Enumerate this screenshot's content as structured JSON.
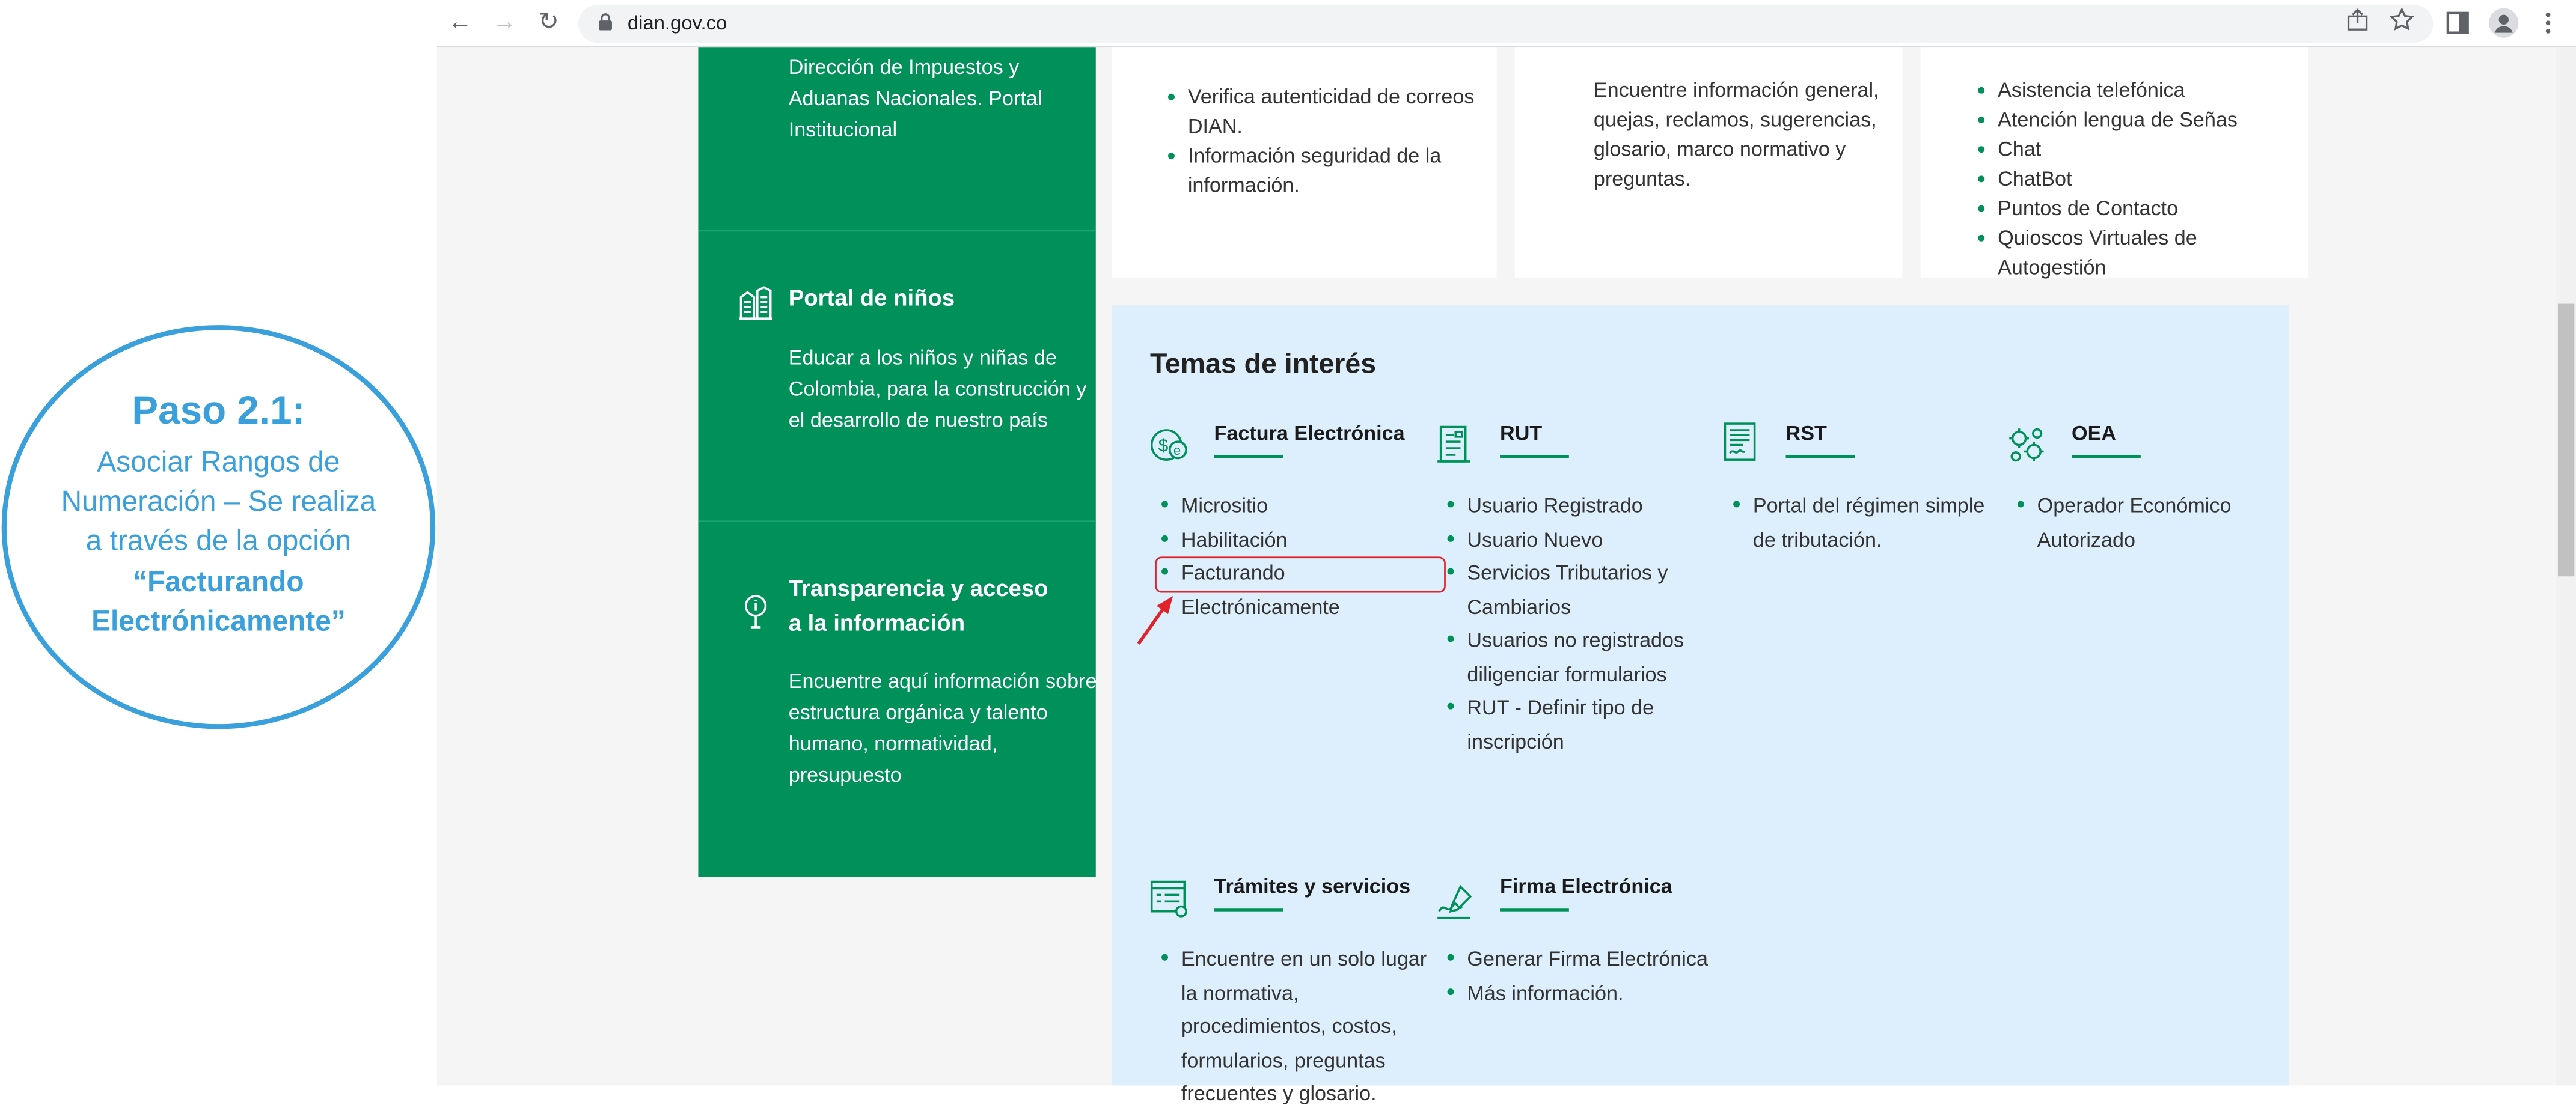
{
  "browser": {
    "url": "dian.gov.co",
    "back_icon": "←",
    "forward_icon": "→",
    "reload_icon": "↻"
  },
  "green_column": {
    "section1_text": [
      "Dirección de Impuestos y",
      "Aduanas Nacionales. Portal",
      "Institucional"
    ],
    "section2_title": "Portal de niños",
    "section2_text": [
      "Educar a los niños y niñas de",
      "Colombia, para la construcción y",
      "el desarrollo de nuestro país"
    ],
    "section3_title": [
      "Transparencia y acceso",
      "a la información"
    ],
    "section3_text": [
      "Encuentre aquí información sobre",
      "estructura orgánica y talento",
      "humano, normatividad,",
      "presupuesto"
    ]
  },
  "cards": {
    "card1": [
      "Verifica autenticidad de correos DIAN.",
      "Información seguridad de la información."
    ],
    "card2": [
      "Encuentre información general,",
      "quejas, reclamos, sugerencias,",
      "glosario, marco normativo y",
      "preguntas."
    ],
    "card3": [
      "Asistencia telefónica",
      "Atención lengua de Señas",
      "Chat",
      "ChatBot",
      "Puntos de Contacto",
      "Quioscos Virtuales de Autogestión"
    ]
  },
  "temas": {
    "title": "Temas de interés",
    "factura": {
      "title": "Factura Electrónica",
      "items": [
        "Micrositio",
        "Habilitación",
        "Facturando Electrónicamente"
      ]
    },
    "rut": {
      "title": "RUT",
      "items": [
        "Usuario Registrado",
        "Usuario Nuevo",
        "Servicios Tributarios y Cambiarios",
        "Usuarios no registrados diligenciar formularios",
        "RUT - Definir tipo de inscripción"
      ]
    },
    "rst": {
      "title": "RST",
      "items": [
        "Portal del régimen simple de tributación."
      ]
    },
    "oea": {
      "title": "OEA",
      "items": [
        " Operador Económico Autorizado"
      ]
    },
    "tramites": {
      "title": "Trámites y servicios",
      "items": [
        "Encuentre en un solo lugar la normativa, procedimientos, costos, formularios, preguntas frecuentes y glosario."
      ]
    },
    "firma": {
      "title": "Firma Electrónica",
      "items": [
        "Generar Firma Electrónica",
        "Más información."
      ]
    }
  },
  "callout": {
    "title": "Paso 2.1:",
    "body": [
      "Asociar Rangos de",
      "Numeración – Se realiza",
      "a través de la opción"
    ],
    "strong": [
      "“Facturando",
      "Electrónicamente”"
    ]
  },
  "colors": {
    "green": "#00915a",
    "blue_panel": "#ddeefc",
    "callout": "#3aa0dc",
    "highlight": "#e0232b"
  }
}
